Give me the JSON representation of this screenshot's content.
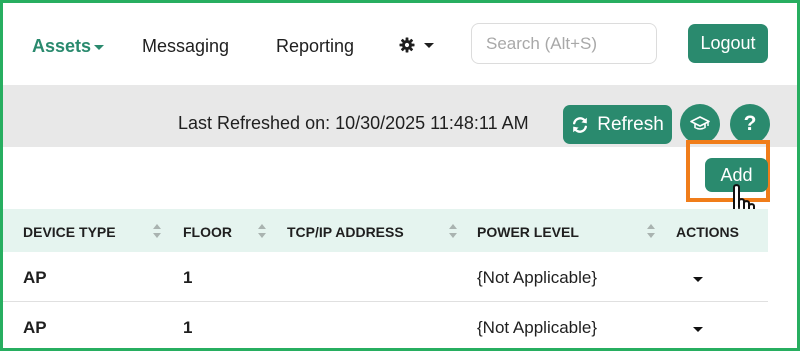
{
  "nav": {
    "assets_label": "Assets",
    "messaging_label": "Messaging",
    "reporting_label": "Reporting",
    "search_placeholder": "Search (Alt+S)",
    "logout_label": "Logout"
  },
  "toolbar": {
    "last_refreshed": "Last Refreshed on: 10/30/2025 11:48:11 AM",
    "refresh_label": "Refresh",
    "help_label": "?",
    "add_label": "Add"
  },
  "table": {
    "headers": [
      "DEVICE TYPE",
      "FLOOR",
      "TCP/IP ADDRESS",
      "POWER LEVEL",
      "ACTIONS"
    ],
    "rows": [
      {
        "device_type": "AP",
        "floor": "1",
        "tcp_ip": "",
        "power_level": "{Not Applicable}"
      },
      {
        "device_type": "AP",
        "floor": "1",
        "tcp_ip": "",
        "power_level": "{Not Applicable}"
      }
    ]
  },
  "colors": {
    "accent": "#2a8a6e",
    "frame_border": "#27ae60",
    "highlight": "#f07d1a",
    "header_bg": "#e5f4ef",
    "toolbar_bg": "#e8e8e8"
  },
  "icons": [
    "chevron-down-icon",
    "gear-icon",
    "refresh-icon",
    "graduation-cap-icon",
    "help-icon",
    "hand-pointer-icon",
    "sort-icon"
  ]
}
